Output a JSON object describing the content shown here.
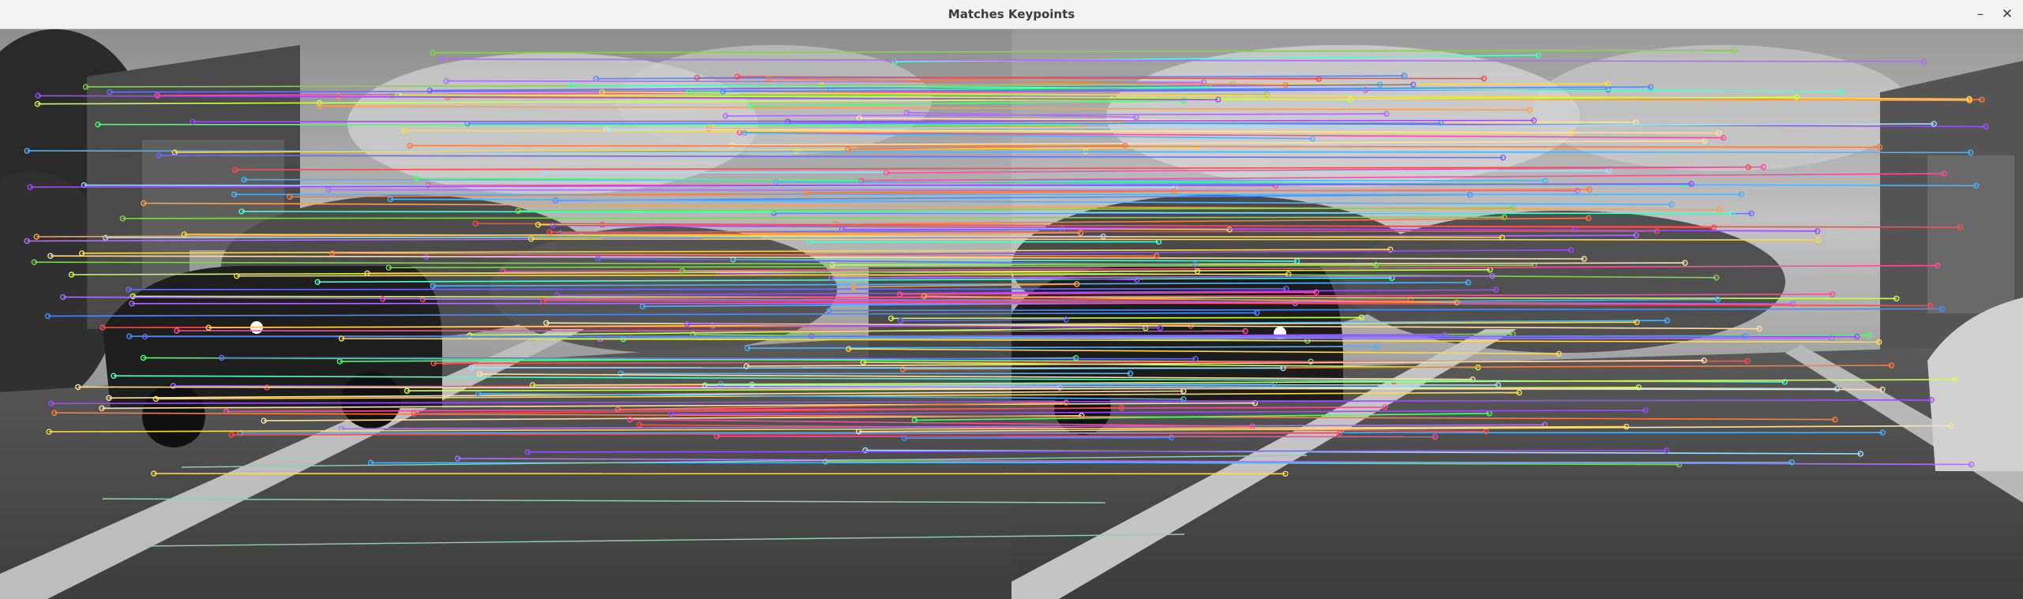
{
  "window": {
    "title": "Matches Keypoints",
    "controls": {
      "minimize": "–",
      "close": "✕"
    }
  },
  "content": {
    "kind": "feature-matching-visualization",
    "left_image": "grayscale street scene: parked dark car, houses, trees, road with white lane marking",
    "right_image": "grayscale street scene: same road, shifted view, car and house on right",
    "match_line_colors": [
      "#7fd64a",
      "#b06cff",
      "#ff7a3c",
      "#4ab3ff",
      "#ffd84a",
      "#ff4a9e",
      "#4affc8",
      "#c8ff4a",
      "#6a6aff",
      "#ff9f4a",
      "#a0e0ff",
      "#ffe0a0",
      "#9d4aff",
      "#4aff6a",
      "#ff4a4a",
      "#4a8cff"
    ]
  }
}
